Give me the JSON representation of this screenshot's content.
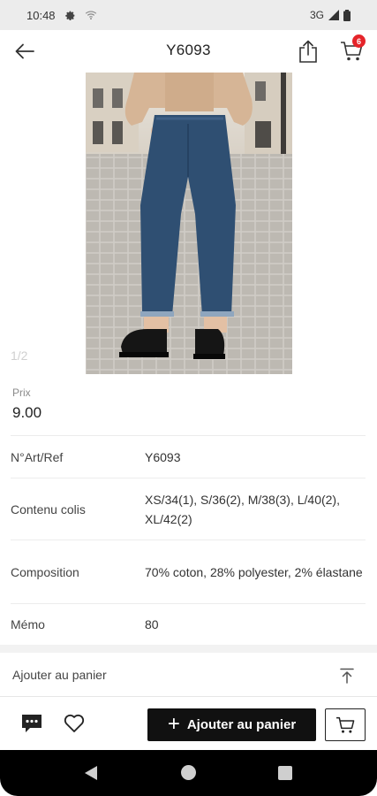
{
  "status_bar": {
    "time": "10:48",
    "network": "3G"
  },
  "header": {
    "title": "Y6093",
    "cart_count": "6"
  },
  "gallery": {
    "counter": "1/2"
  },
  "price": {
    "label": "Prix",
    "value": "9.00"
  },
  "details": [
    {
      "label": "N°Art/Ref",
      "value": "Y6093"
    },
    {
      "label": "Contenu colis",
      "value": "XS/34(1), S/36(2), M/38(3), L/40(2), XL/42(2)"
    },
    {
      "label": "Composition",
      "value": "70% coton, 28% polyester, 2% élastane"
    },
    {
      "label": "Mémo",
      "value": "80"
    }
  ],
  "add_row": {
    "label": "Ajouter au panier"
  },
  "bottom_bar": {
    "primary_label": "Ajouter au panier"
  },
  "colors": {
    "accent_badge": "#e5242a",
    "primary_button": "#111111"
  },
  "icons": [
    "back-arrow-icon",
    "share-icon",
    "cart-icon",
    "scroll-top-icon",
    "chat-icon",
    "heart-icon",
    "plus-icon",
    "cart-outline-icon"
  ]
}
